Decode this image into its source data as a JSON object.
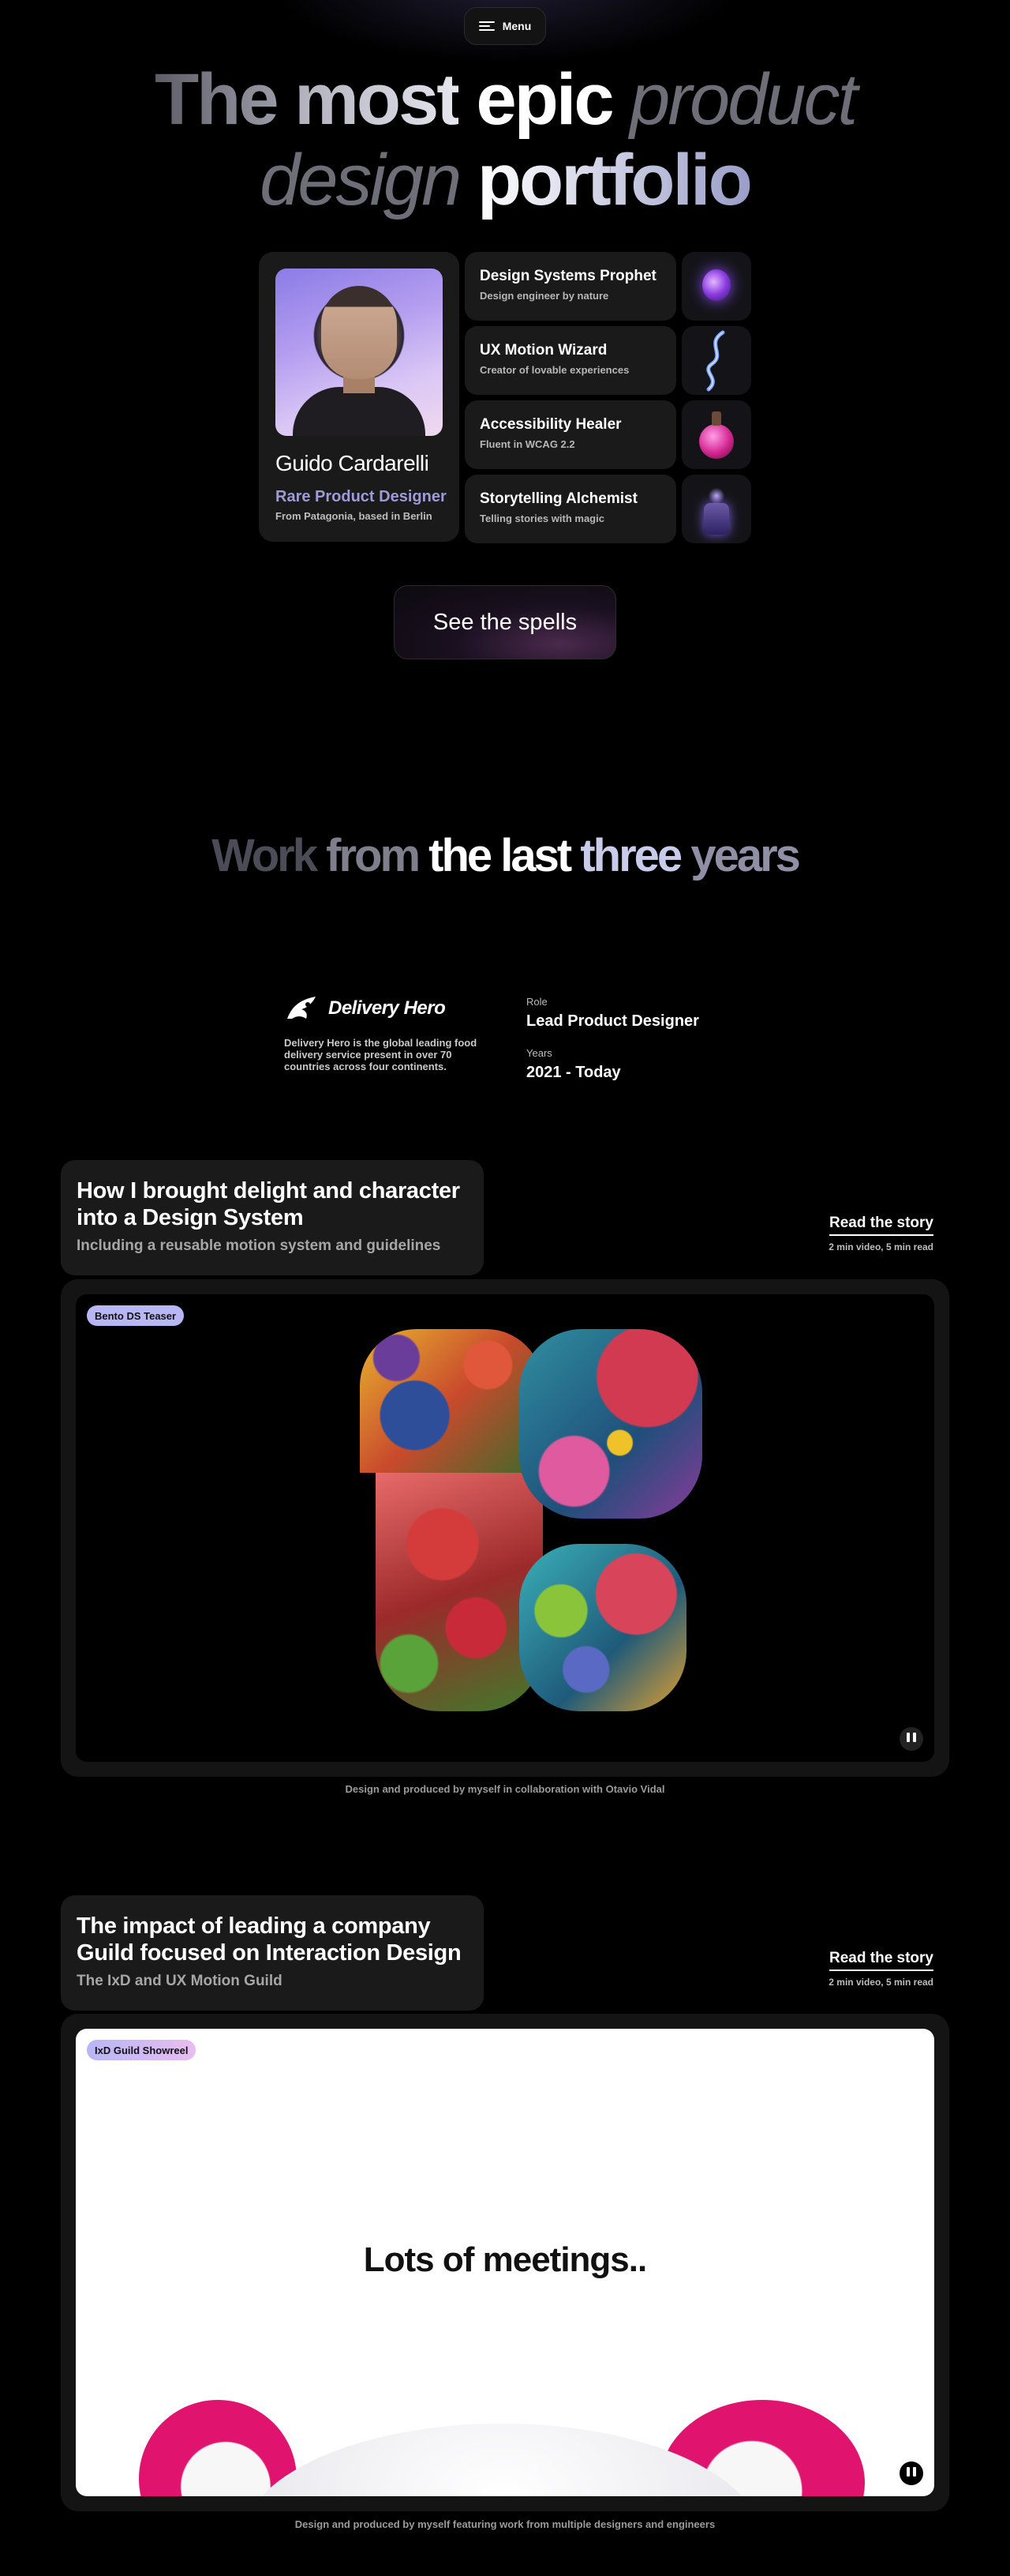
{
  "nav": {
    "menu_label": "Menu"
  },
  "hero": {
    "w1": "The",
    "w2": "most",
    "w3": "epic",
    "w4": "product",
    "w5": "design",
    "w6": "portfolio"
  },
  "profile": {
    "name": "Guido Cardarelli",
    "role": "Rare Product Designer",
    "location": "From Patagonia, based in Berlin"
  },
  "skills": [
    {
      "title": "Design Systems Prophet",
      "subtitle": "Design engineer by nature"
    },
    {
      "title": "UX Motion Wizard",
      "subtitle": "Creator of lovable experiences"
    },
    {
      "title": "Accessibility Healer",
      "subtitle": "Fluent in WCAG 2.2"
    },
    {
      "title": "Storytelling Alchemist",
      "subtitle": "Telling stories with magic"
    }
  ],
  "cta": {
    "label": "See the spells"
  },
  "work": {
    "title_words": [
      "Work",
      "from",
      "the",
      "last",
      "three",
      "years"
    ],
    "company": {
      "name": "Delivery Hero",
      "description": "Delivery Hero is the global leading food delivery service present in over 70 countries across four continents.",
      "role_label": "Role",
      "role_value": "Lead Product Designer",
      "years_label": "Years",
      "years_value": "2021 - Today"
    }
  },
  "stories": [
    {
      "headline": "How I brought delight and character into a Design System",
      "subtitle": "Including a reusable motion system and guidelines",
      "read_label": "Read the story",
      "read_time": "2 min video, 5 min read",
      "badge": "Bento DS Teaser",
      "caption": "Design and produced by myself in collaboration with Otavio Vidal"
    },
    {
      "headline": "The impact of leading a company Guild focused on Interaction Design",
      "subtitle": "The IxD and UX Motion Guild",
      "read_label": "Read the story",
      "read_time": "2 min video, 5 min read",
      "badge": "IxD Guild Showreel",
      "video_text": "Lots of meetings..",
      "caption": "Design and produced by myself featuring work from multiple designers and engineers"
    }
  ],
  "colors": {
    "background": "#000000",
    "card": "#1a1a1a",
    "accent_purple": "#9d9bd8",
    "badge_1": "#b8b6f5",
    "badge_2": "#d9b9ef"
  },
  "icons": [
    "menu-icon",
    "delivery-hero-logo-icon",
    "pause-icon"
  ]
}
